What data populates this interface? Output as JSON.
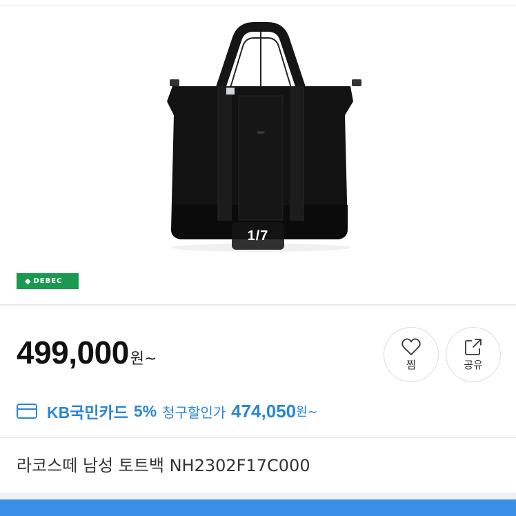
{
  "gallery": {
    "counter": "1/7"
  },
  "brand": {
    "logo_text": "DEBEC",
    "logo_color": "#1a9a4e"
  },
  "price": {
    "amount": "499,000",
    "unit": "원~"
  },
  "actions": {
    "like_label": "찜",
    "like_icon": "heart-icon",
    "share_label": "공유",
    "share_icon": "share-icon"
  },
  "discount": {
    "card_icon": "credit-card-icon",
    "card_name": "KB국민카드",
    "rate": "5%",
    "text": "청구할인가",
    "sale_amount": "474,050",
    "sale_unit": "원~",
    "color": "#2a86d4"
  },
  "product": {
    "name": "라코스떼 남성 토트백 NH2302F17C000"
  },
  "bottom_bar": {
    "color": "#3b8fe6"
  }
}
